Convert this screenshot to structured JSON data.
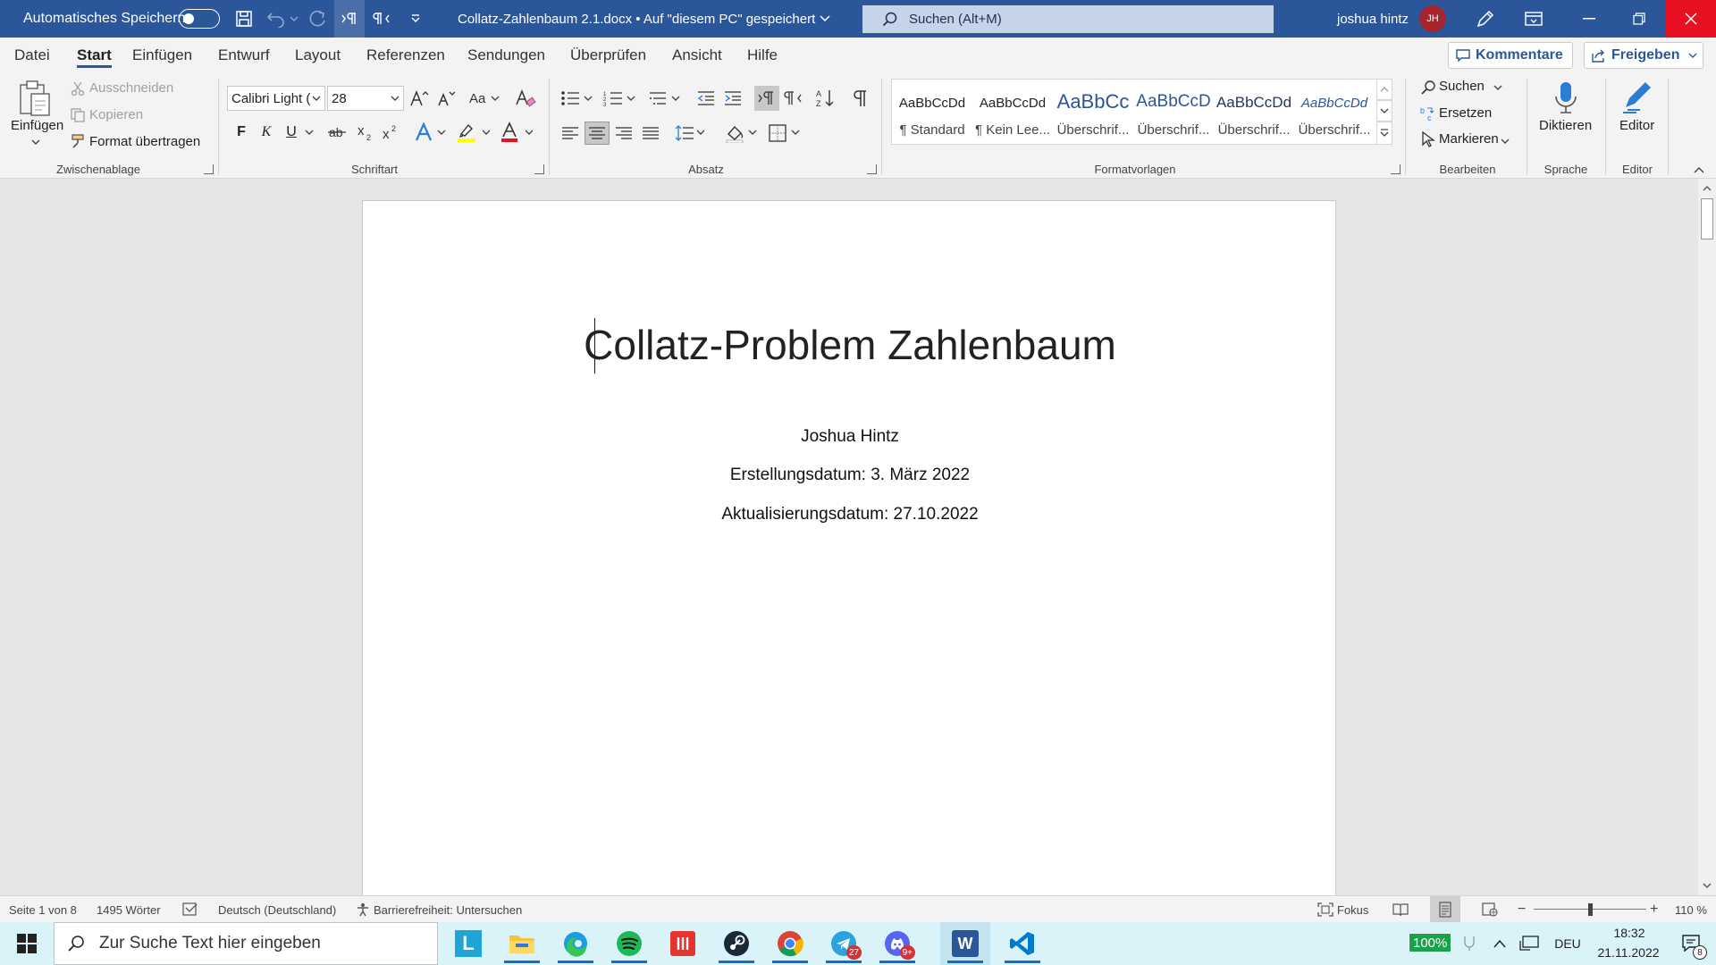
{
  "titlebar": {
    "autosave_label": "Automatisches Speichern",
    "autosave_state": "off",
    "document_title": "Collatz-Zahlenbaum 2.1.docx • Auf \"diesem PC\" gespeichert",
    "search_placeholder": "Suchen (Alt+M)",
    "user_name": "joshua hintz",
    "user_initials": "JH"
  },
  "tabs": [
    {
      "label": "Datei"
    },
    {
      "label": "Start",
      "active": true
    },
    {
      "label": "Einfügen"
    },
    {
      "label": "Entwurf"
    },
    {
      "label": "Layout"
    },
    {
      "label": "Referenzen"
    },
    {
      "label": "Sendungen"
    },
    {
      "label": "Überprüfen"
    },
    {
      "label": "Ansicht"
    },
    {
      "label": "Hilfe"
    }
  ],
  "tab_actions": {
    "comments": "Kommentare",
    "share": "Freigeben"
  },
  "ribbon": {
    "clipboard": {
      "paste": "Einfügen",
      "cut": "Ausschneiden",
      "copy": "Kopieren",
      "format_painter": "Format übertragen",
      "label": "Zwischenablage"
    },
    "font": {
      "font_name": "Calibri Light (",
      "font_size": "28",
      "bold": "F",
      "italic": "K",
      "underline": "U",
      "label": "Schriftart",
      "highlight_color": "#ffff00",
      "font_color": "#e81123"
    },
    "paragraph": {
      "label": "Absatz"
    },
    "styles": {
      "label": "Formatvorlagen",
      "items": [
        {
          "sample": "AaBbCcDd",
          "name": "¶ Standard"
        },
        {
          "sample": "AaBbCcDd",
          "name": "¶ Kein Lee..."
        },
        {
          "sample": "AaBbCc",
          "name": "Überschrif..."
        },
        {
          "sample": "AaBbCcD",
          "name": "Überschrif..."
        },
        {
          "sample": "AaBbCcDd",
          "name": "Überschrif..."
        },
        {
          "sample": "AaBbCcDd",
          "name": "Überschrif..."
        }
      ]
    },
    "editing": {
      "find": "Suchen",
      "replace": "Ersetzen",
      "select": "Markieren",
      "label": "Bearbeiten"
    },
    "voice": {
      "dictate": "Diktieren",
      "label": "Sprache"
    },
    "editor": {
      "editor": "Editor",
      "label": "Editor"
    }
  },
  "document": {
    "title": "Collatz-Problem Zahlenbaum",
    "author": "Joshua Hintz",
    "created": "Erstellungsdatum: 3. März 2022",
    "updated": "Aktualisierungsdatum: 27.10.2022"
  },
  "statusbar": {
    "page": "Seite 1 von 8",
    "words": "1495 Wörter",
    "language": "Deutsch (Deutschland)",
    "accessibility": "Barrierefreiheit: Untersuchen",
    "focus": "Fokus",
    "zoom_minus": "−",
    "zoom_plus": "+",
    "zoom": "110 %",
    "zoom_fraction": 0.5
  },
  "taskbar": {
    "search_placeholder": "Zur Suche Text hier eingeben",
    "apps": [
      {
        "name": "launcher-l-app",
        "label": "L"
      },
      {
        "name": "file-explorer-app"
      },
      {
        "name": "edge-app"
      },
      {
        "name": "spotify-app"
      },
      {
        "name": "red-app"
      },
      {
        "name": "steam-app"
      },
      {
        "name": "chrome-app"
      },
      {
        "name": "telegram-app",
        "badge": "27"
      },
      {
        "name": "discord-app",
        "badge": "9+"
      },
      {
        "name": "word-app",
        "label": "W"
      },
      {
        "name": "vscode-app"
      }
    ],
    "battery": "100%",
    "input_language": "DEU",
    "time": "18:32",
    "date": "21.11.2022",
    "notifications": "8"
  }
}
